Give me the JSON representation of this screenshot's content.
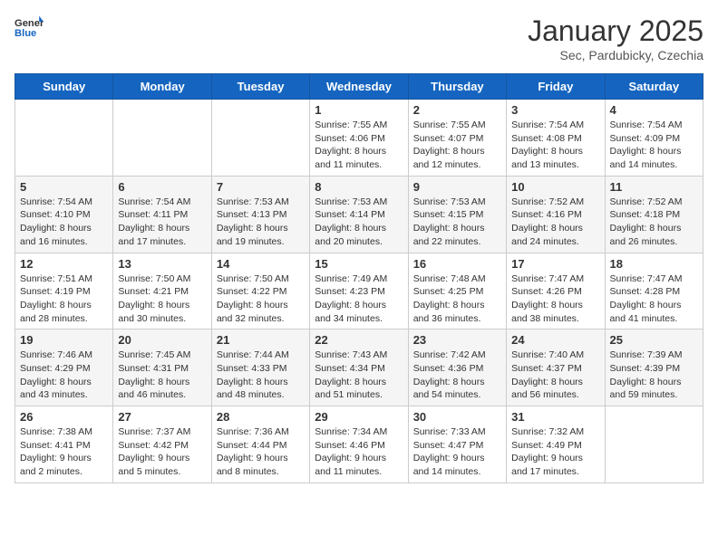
{
  "logo": {
    "general": "General",
    "blue": "Blue"
  },
  "header": {
    "month": "January 2025",
    "location": "Sec, Pardubicky, Czechia"
  },
  "weekdays": [
    "Sunday",
    "Monday",
    "Tuesday",
    "Wednesday",
    "Thursday",
    "Friday",
    "Saturday"
  ],
  "weeks": [
    [
      {
        "day": "",
        "info": ""
      },
      {
        "day": "",
        "info": ""
      },
      {
        "day": "",
        "info": ""
      },
      {
        "day": "1",
        "info": "Sunrise: 7:55 AM\nSunset: 4:06 PM\nDaylight: 8 hours and 11 minutes."
      },
      {
        "day": "2",
        "info": "Sunrise: 7:55 AM\nSunset: 4:07 PM\nDaylight: 8 hours and 12 minutes."
      },
      {
        "day": "3",
        "info": "Sunrise: 7:54 AM\nSunset: 4:08 PM\nDaylight: 8 hours and 13 minutes."
      },
      {
        "day": "4",
        "info": "Sunrise: 7:54 AM\nSunset: 4:09 PM\nDaylight: 8 hours and 14 minutes."
      }
    ],
    [
      {
        "day": "5",
        "info": "Sunrise: 7:54 AM\nSunset: 4:10 PM\nDaylight: 8 hours and 16 minutes."
      },
      {
        "day": "6",
        "info": "Sunrise: 7:54 AM\nSunset: 4:11 PM\nDaylight: 8 hours and 17 minutes."
      },
      {
        "day": "7",
        "info": "Sunrise: 7:53 AM\nSunset: 4:13 PM\nDaylight: 8 hours and 19 minutes."
      },
      {
        "day": "8",
        "info": "Sunrise: 7:53 AM\nSunset: 4:14 PM\nDaylight: 8 hours and 20 minutes."
      },
      {
        "day": "9",
        "info": "Sunrise: 7:53 AM\nSunset: 4:15 PM\nDaylight: 8 hours and 22 minutes."
      },
      {
        "day": "10",
        "info": "Sunrise: 7:52 AM\nSunset: 4:16 PM\nDaylight: 8 hours and 24 minutes."
      },
      {
        "day": "11",
        "info": "Sunrise: 7:52 AM\nSunset: 4:18 PM\nDaylight: 8 hours and 26 minutes."
      }
    ],
    [
      {
        "day": "12",
        "info": "Sunrise: 7:51 AM\nSunset: 4:19 PM\nDaylight: 8 hours and 28 minutes."
      },
      {
        "day": "13",
        "info": "Sunrise: 7:50 AM\nSunset: 4:21 PM\nDaylight: 8 hours and 30 minutes."
      },
      {
        "day": "14",
        "info": "Sunrise: 7:50 AM\nSunset: 4:22 PM\nDaylight: 8 hours and 32 minutes."
      },
      {
        "day": "15",
        "info": "Sunrise: 7:49 AM\nSunset: 4:23 PM\nDaylight: 8 hours and 34 minutes."
      },
      {
        "day": "16",
        "info": "Sunrise: 7:48 AM\nSunset: 4:25 PM\nDaylight: 8 hours and 36 minutes."
      },
      {
        "day": "17",
        "info": "Sunrise: 7:47 AM\nSunset: 4:26 PM\nDaylight: 8 hours and 38 minutes."
      },
      {
        "day": "18",
        "info": "Sunrise: 7:47 AM\nSunset: 4:28 PM\nDaylight: 8 hours and 41 minutes."
      }
    ],
    [
      {
        "day": "19",
        "info": "Sunrise: 7:46 AM\nSunset: 4:29 PM\nDaylight: 8 hours and 43 minutes."
      },
      {
        "day": "20",
        "info": "Sunrise: 7:45 AM\nSunset: 4:31 PM\nDaylight: 8 hours and 46 minutes."
      },
      {
        "day": "21",
        "info": "Sunrise: 7:44 AM\nSunset: 4:33 PM\nDaylight: 8 hours and 48 minutes."
      },
      {
        "day": "22",
        "info": "Sunrise: 7:43 AM\nSunset: 4:34 PM\nDaylight: 8 hours and 51 minutes."
      },
      {
        "day": "23",
        "info": "Sunrise: 7:42 AM\nSunset: 4:36 PM\nDaylight: 8 hours and 54 minutes."
      },
      {
        "day": "24",
        "info": "Sunrise: 7:40 AM\nSunset: 4:37 PM\nDaylight: 8 hours and 56 minutes."
      },
      {
        "day": "25",
        "info": "Sunrise: 7:39 AM\nSunset: 4:39 PM\nDaylight: 8 hours and 59 minutes."
      }
    ],
    [
      {
        "day": "26",
        "info": "Sunrise: 7:38 AM\nSunset: 4:41 PM\nDaylight: 9 hours and 2 minutes."
      },
      {
        "day": "27",
        "info": "Sunrise: 7:37 AM\nSunset: 4:42 PM\nDaylight: 9 hours and 5 minutes."
      },
      {
        "day": "28",
        "info": "Sunrise: 7:36 AM\nSunset: 4:44 PM\nDaylight: 9 hours and 8 minutes."
      },
      {
        "day": "29",
        "info": "Sunrise: 7:34 AM\nSunset: 4:46 PM\nDaylight: 9 hours and 11 minutes."
      },
      {
        "day": "30",
        "info": "Sunrise: 7:33 AM\nSunset: 4:47 PM\nDaylight: 9 hours and 14 minutes."
      },
      {
        "day": "31",
        "info": "Sunrise: 7:32 AM\nSunset: 4:49 PM\nDaylight: 9 hours and 17 minutes."
      },
      {
        "day": "",
        "info": ""
      }
    ]
  ]
}
